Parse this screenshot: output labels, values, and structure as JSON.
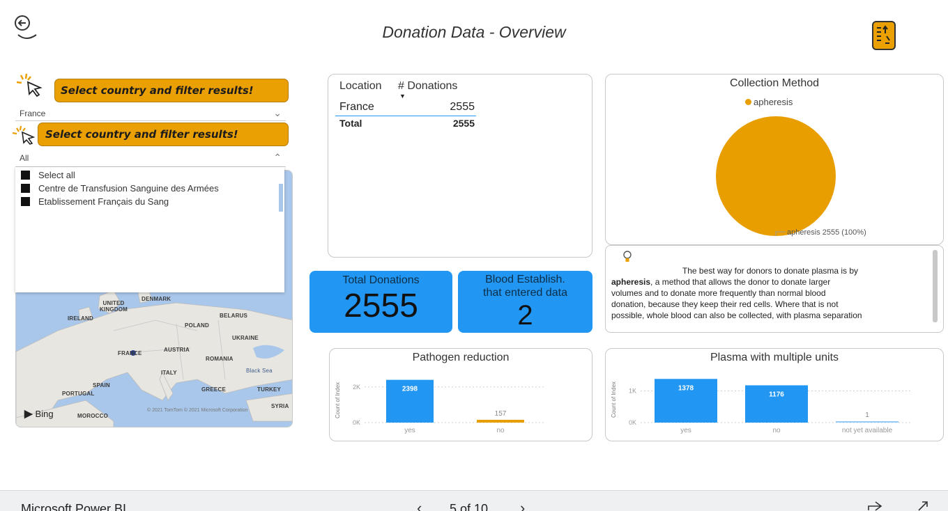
{
  "header": {
    "title": "Donation Data - Overview",
    "back_icon": "back-arrow-icon",
    "report_icon": "document-icon"
  },
  "slicers": {
    "banner_1": "Select country and filter results!",
    "country_value": "France",
    "banner_2": "Select country and filter results!",
    "establishment_value": "All",
    "options": [
      "Select all",
      "Centre de Transfusion Sanguine des Armées",
      "Etablissement Français du Sang"
    ]
  },
  "map": {
    "labels": {
      "denmark": "DENMARK",
      "uk": "UNITED KINGDOM",
      "ireland": "IRELAND",
      "belarus": "BELARUS",
      "poland": "POLAND",
      "ukraine": "UKRAINE",
      "france": "FRANCE",
      "austria": "AUSTRIA",
      "romania": "ROMANIA",
      "blacksea": "Black Sea",
      "italy": "ITALY",
      "spain": "SPAIN",
      "portugal": "PORTUGAL",
      "greece": "GREECE",
      "turkey": "TURKEY",
      "syria": "SYRIA",
      "morocco": "MOROCCO"
    },
    "bing": "Bing",
    "copyright": "© 2021 TomTom © 2021 Microsoft Corporation",
    "colors": {
      "land": "#e8e6e1",
      "water": "#a9c7ea",
      "marker": "#2b3f8f"
    }
  },
  "table": {
    "col_location": "Location",
    "col_donations": "# Donations",
    "rows": [
      {
        "location": "France",
        "donations": "2555"
      }
    ],
    "total_label": "Total",
    "total_value": "2555"
  },
  "kpis": {
    "total_label": "Total Donations",
    "total_value": "2555",
    "establish_label_1": "Blood Establish.",
    "establish_label_2": "that entered data",
    "establish_value": "2"
  },
  "info": {
    "icon": "lightbulb-icon",
    "line1": "The best way for donors to donate plasma is by",
    "bold": "apheresis",
    "line2_rest": ", a method that allows the donor to donate larger",
    "line3": "volumes and to donate more frequently than normal blood",
    "line4": "donation, because they keep their red cells. Where that is not",
    "line5": "possible, whole blood can also be collected, with plasma separation"
  },
  "chart_data": [
    {
      "type": "pie",
      "title": "Collection Method",
      "categories": [
        "apheresis"
      ],
      "values": [
        2555
      ],
      "legend": [
        "apheresis"
      ],
      "legend_position": "top",
      "data_label": "apheresis 2555 (100%)",
      "colors": [
        "#e99e00"
      ]
    },
    {
      "type": "bar",
      "title": "Pathogen reduction",
      "categories": [
        "yes",
        "no"
      ],
      "values": [
        2398,
        157
      ],
      "ylabel": "Count of Index",
      "ytick_labels": [
        "0K",
        "2K"
      ],
      "ylim": [
        0,
        2500
      ],
      "grid": true,
      "colors": [
        "#2196f3",
        "#e99e00"
      ]
    },
    {
      "type": "bar",
      "title": "Plasma with multiple units",
      "categories": [
        "yes",
        "no",
        "not yet available"
      ],
      "values": [
        1378,
        1176,
        1
      ],
      "ylabel": "Count of Index",
      "ytick_labels": [
        "0K",
        "1K"
      ],
      "ylim": [
        0,
        1450
      ],
      "grid": true,
      "colors": [
        "#2196f3",
        "#2196f3",
        "#90caf9"
      ]
    }
  ],
  "footer": {
    "app_name": "Microsoft Power BI",
    "page_indicator": "5 of 10",
    "prev_icon": "chevron-left-icon",
    "next_icon": "chevron-right-icon",
    "share_icon": "share-icon",
    "expand_icon": "expand-icon"
  }
}
